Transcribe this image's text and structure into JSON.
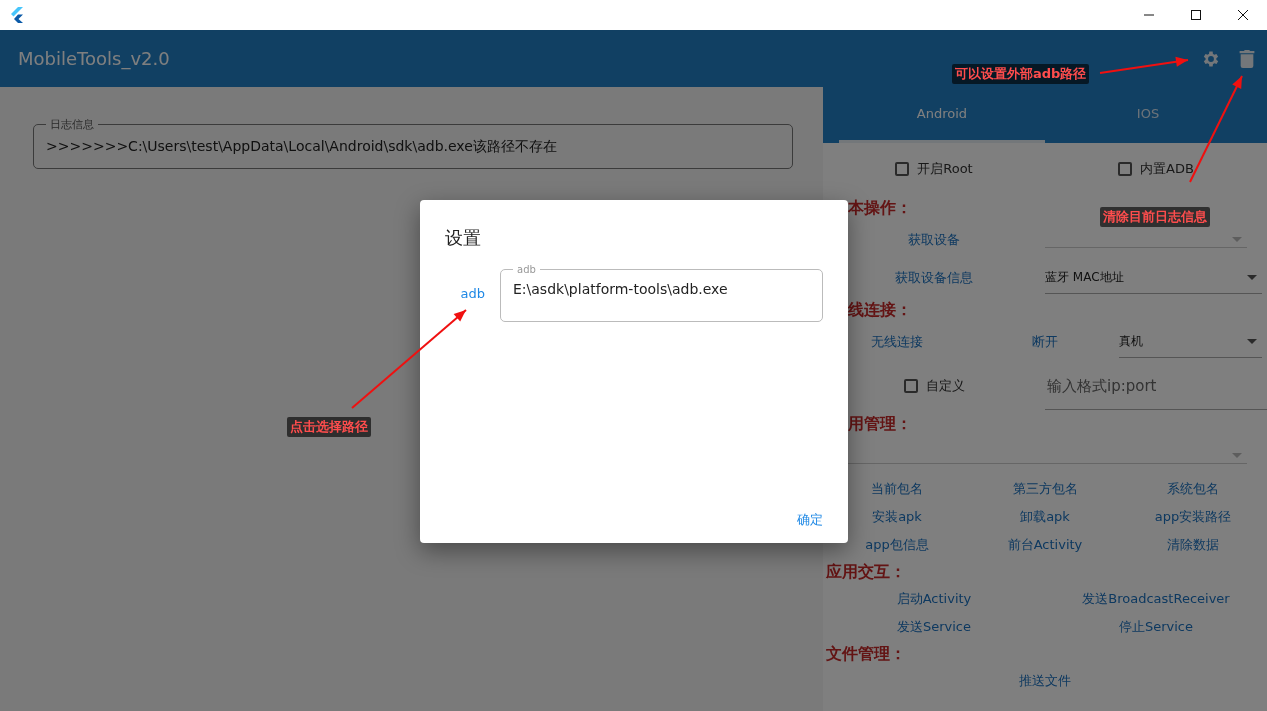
{
  "app_bar": {
    "title": "MobileTools_v2.0"
  },
  "log_panel": {
    "label": "日志信息",
    "text": ">>>>>>>C:\\Users\\test\\AppData\\Local\\Android\\sdk\\adb.exe该路径不存在"
  },
  "tabs": [
    {
      "label": "Android",
      "selected": true
    },
    {
      "label": "IOS",
      "selected": false
    }
  ],
  "options": [
    {
      "label": "开启Root",
      "checked": false
    },
    {
      "label": "内置ADB",
      "checked": false
    }
  ],
  "sections": [
    {
      "title": "本操作：",
      "rows": [
        {
          "cells": [
            {
              "kind": "link",
              "label": "获取设备"
            },
            {
              "kind": "dropdown"
            }
          ]
        },
        {
          "cells": [
            {
              "kind": "link",
              "label": "获取设备信息"
            },
            {
              "kind": "dropdown",
              "value": "蓝牙 MAC地址"
            }
          ]
        }
      ]
    },
    {
      "title": "线连接：",
      "rows": [
        {
          "cells": [
            {
              "kind": "link",
              "label": "无线连接"
            },
            {
              "kind": "link",
              "label": "断开"
            },
            {
              "kind": "dropdown",
              "value": "真机"
            }
          ]
        },
        {
          "cells": [
            {
              "kind": "checkbox",
              "label": "自定义",
              "checked": false
            },
            {
              "kind": "input",
              "placeholder": "输入格式ip:port"
            }
          ]
        }
      ]
    },
    {
      "title": "用管理：",
      "rows": [
        {
          "cells": [
            {
              "kind": "dropdown"
            }
          ]
        },
        {
          "cells": [
            {
              "kind": "link",
              "label": "当前包名"
            },
            {
              "kind": "link",
              "label": "第三方包名"
            },
            {
              "kind": "link",
              "label": "系统包名"
            }
          ]
        },
        {
          "cells": [
            {
              "kind": "link",
              "label": "安装apk"
            },
            {
              "kind": "link",
              "label": "卸载apk"
            },
            {
              "kind": "link",
              "label": "app安装路径"
            }
          ]
        },
        {
          "cells": [
            {
              "kind": "link",
              "label": "app包信息"
            },
            {
              "kind": "link",
              "label": "前台Activity"
            },
            {
              "kind": "link",
              "label": "清除数据"
            }
          ]
        }
      ]
    },
    {
      "title": "应用交互：",
      "rows": [
        {
          "cells": [
            {
              "kind": "link",
              "label": "启动Activity"
            },
            {
              "kind": "link",
              "label": "发送BroadcastReceiver"
            }
          ]
        },
        {
          "cells": [
            {
              "kind": "link",
              "label": "发送Service"
            },
            {
              "kind": "link",
              "label": "停止Service"
            }
          ]
        }
      ]
    },
    {
      "title": "文件管理：",
      "rows": [
        {
          "cells": [
            {
              "kind": "link",
              "label": "推送文件"
            }
          ]
        }
      ]
    }
  ],
  "dialog": {
    "title": "设置",
    "fields": [
      {
        "button": "adb",
        "label": "adb",
        "value": "E:\\asdk\\platform-tools\\adb.exe"
      }
    ],
    "actions": [
      "确定"
    ]
  },
  "annotations": [
    {
      "text": "可以设置外部adb路径"
    },
    {
      "text": "清除目前日志信息"
    },
    {
      "text": "点击选择路径"
    }
  ]
}
